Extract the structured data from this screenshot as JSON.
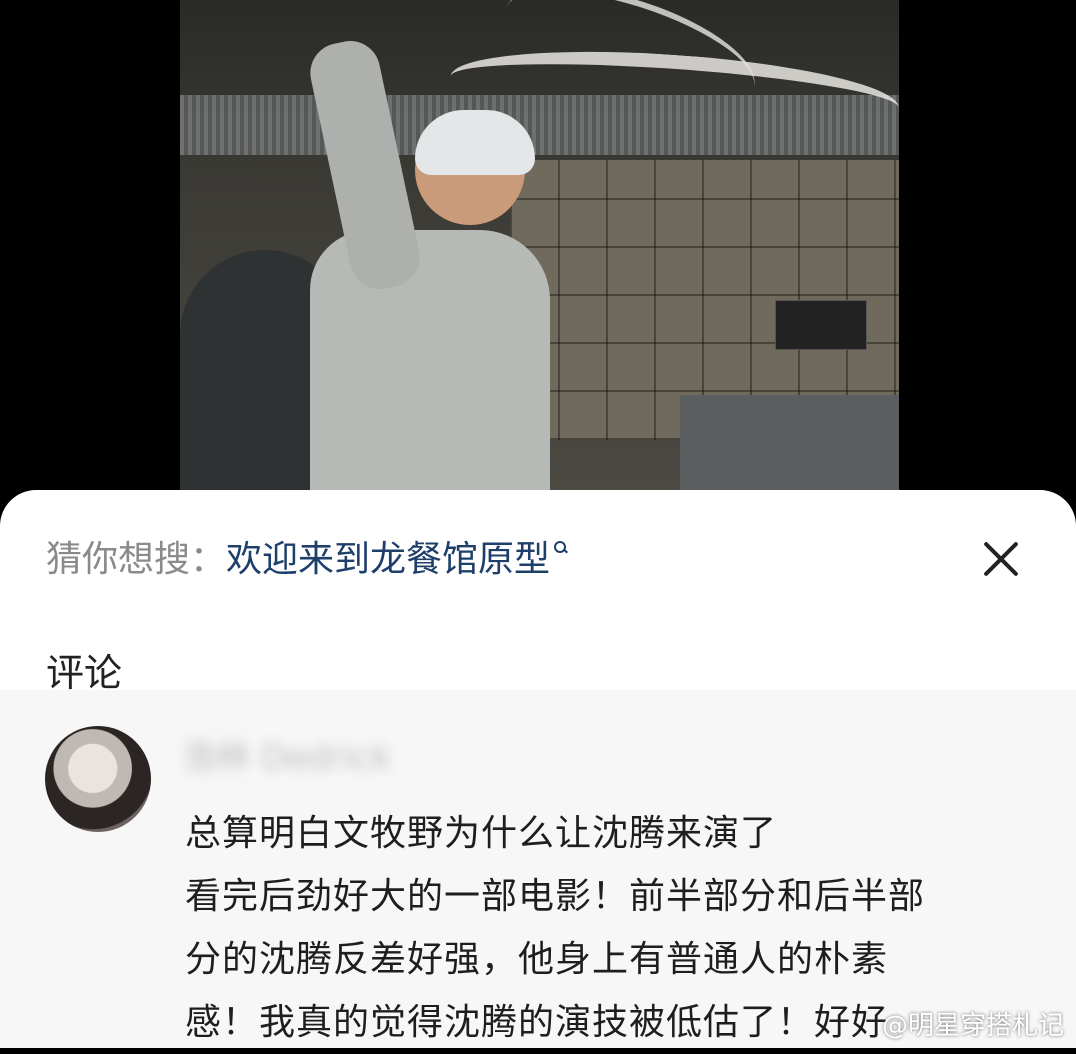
{
  "search_suggestion": {
    "prefix": "猜你想搜：",
    "query": "欢迎来到龙餐馆原型"
  },
  "comments_section": {
    "title": "评论"
  },
  "comment": {
    "username": "浩林 Dedrick",
    "lines": [
      "总算明白文牧野为什么让沈腾来演了",
      "看完后劲好大的一部电影！前半部分和后半部",
      "分的沈腾反差好强，他身上有普通人的朴素",
      "感！我真的觉得沈腾的演技被低估了！好好"
    ]
  },
  "watermark": "@明星穿搭札记",
  "icons": [
    "search-icon",
    "close-icon"
  ]
}
